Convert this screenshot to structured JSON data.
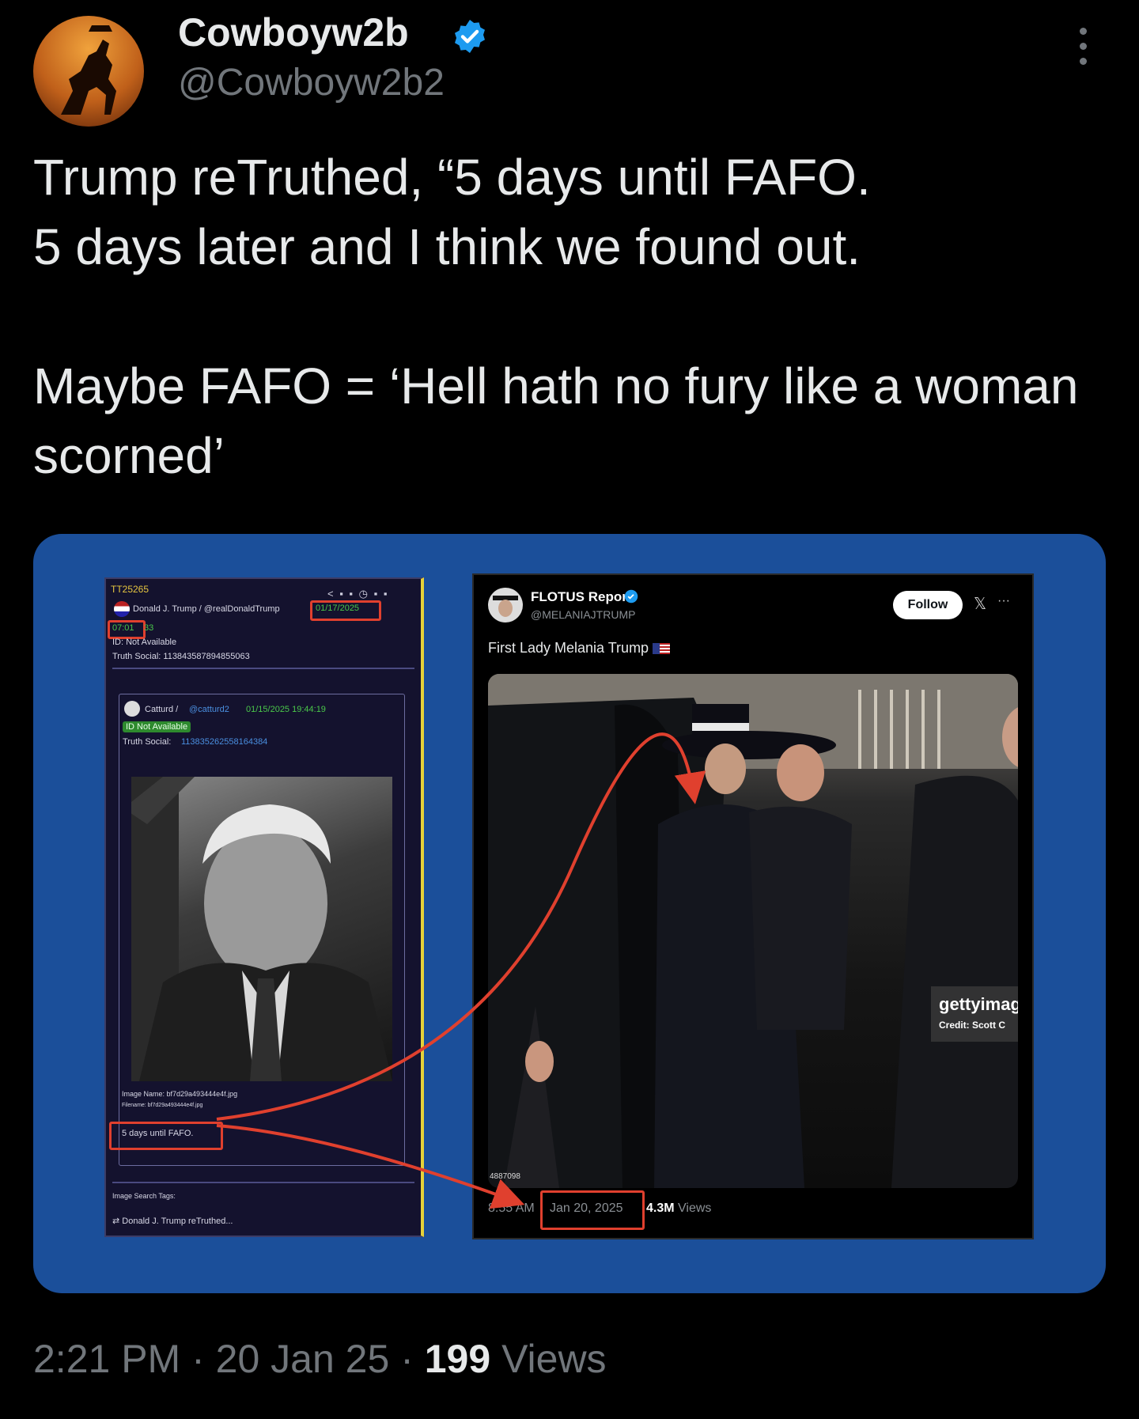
{
  "header": {
    "display_name": "Cowboyw2b",
    "handle": "@Cowboyw2b2"
  },
  "tweet": {
    "text": "Trump reTruthed, “5 days until FAFO.\n5 days later and I think we found out.\n\nMaybe FAFO = ‘Hell hath no fury like a woman scorned’"
  },
  "media": {
    "truth": {
      "id": "TT25265",
      "author": "Donald J. Trump / @realDonaldTrump",
      "date": "01/17/2025",
      "time_boxed": "07:01",
      "time_rest": "33",
      "id_status": "ID: Not Available",
      "truth_social": "Truth Social: 113843587894855063",
      "quoted": {
        "author": "Catturd /",
        "handle": "@catturd2",
        "datetime": "01/15/2025 19:44:19",
        "id_status": "ID Not Available",
        "truth_social_label": "Truth Social:",
        "truth_social_id": "113835262558164384"
      },
      "image_name": "Image Name: bf7d29a493444e4f.jpg",
      "filename": "Filename: bf7d29a493444e4f.jpg",
      "caption": "5 days until FAFO.",
      "search_tags": "Image Search Tags:",
      "retruth": "Donald J. Trump  reTruthed..."
    },
    "flotus": {
      "name": "FLOTUS Report",
      "handle": "@MELANIAJTRUMP",
      "follow": "Follow",
      "caption": "First Lady Melania Trump",
      "getty_brand": "gettyimag",
      "getty_credit": "Credit: Scott C",
      "photo_id": "4887098",
      "time": "8:55 AM",
      "date": "Jan 20, 2025",
      "views_count": "4.3M",
      "views_label": "Views"
    }
  },
  "footer": {
    "time": "2:21 PM",
    "date": "20 Jan 25",
    "views_count": "199",
    "views_label": "Views"
  },
  "colors": {
    "background": "#000000",
    "text": "#e7e9ea",
    "muted": "#71767b",
    "verified": "#1d9bf0",
    "media_bg": "#1b4f9a",
    "annotation_red": "#e0402e"
  }
}
